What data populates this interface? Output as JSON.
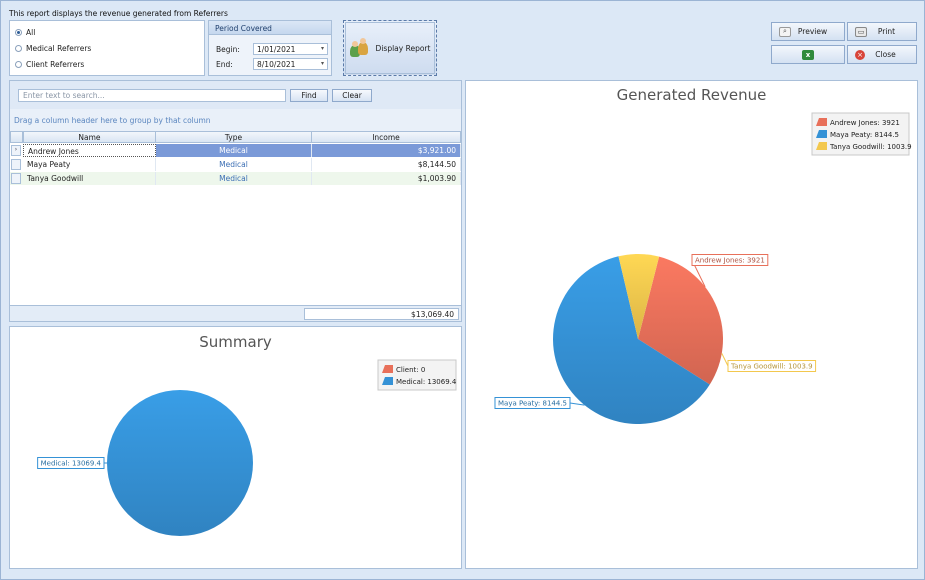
{
  "description": "This report displays the revenue generated from Referrers",
  "filter": {
    "options": [
      {
        "label": "All",
        "selected": true
      },
      {
        "label": "Medical Referrers",
        "selected": false
      },
      {
        "label": "Client Referrers",
        "selected": false
      }
    ]
  },
  "period": {
    "title": "Period Covered",
    "begin_label": "Begin:",
    "begin_value": "1/01/2021",
    "end_label": "End:",
    "end_value": "8/10/2021"
  },
  "display_button": "Display Report",
  "toolbar": {
    "preview": "Preview",
    "print": "Print",
    "close": "Close"
  },
  "search": {
    "placeholder": "Enter text to search...",
    "find": "Find",
    "clear": "Clear"
  },
  "group_hint": "Drag a column header here to group by that column",
  "table": {
    "columns": [
      "Name",
      "Type",
      "Income"
    ],
    "rows": [
      {
        "name": "Andrew Jones",
        "type": "Medical",
        "income": "$3,921.00"
      },
      {
        "name": "Maya Peaty",
        "type": "Medical",
        "income": "$8,144.50"
      },
      {
        "name": "Tanya Goodwill",
        "type": "Medical",
        "income": "$1,003.90"
      }
    ],
    "total": "$13,069.40"
  },
  "colors": {
    "andrew": "#e8705a",
    "maya": "#3592d6",
    "tanya": "#f3c84e"
  },
  "chart_data": [
    {
      "type": "pie",
      "title": "Summary",
      "slices": [
        {
          "label": "Client",
          "value": 0,
          "legend": "Client: 0",
          "color": "#e8705a"
        },
        {
          "label": "Medical",
          "value": 13069.4,
          "legend": "Medical: 13069.4",
          "color": "#3592d6"
        }
      ],
      "callouts": [
        "Medical: 13069.4"
      ],
      "legend_position": "top-right"
    },
    {
      "type": "pie",
      "title": "Generated Revenue",
      "slices": [
        {
          "label": "Andrew Jones",
          "value": 3921,
          "legend": "Andrew Jones: 3921",
          "color": "#e8705a"
        },
        {
          "label": "Maya Peaty",
          "value": 8144.5,
          "legend": "Maya Peaty: 8144.5",
          "color": "#3592d6"
        },
        {
          "label": "Tanya Goodwill",
          "value": 1003.9,
          "legend": "Tanya Goodwill: 1003.9",
          "color": "#f3c84e"
        }
      ],
      "callouts": [
        "Andrew Jones: 3921",
        "Tanya Goodwill: 1003.9",
        "Maya Peaty: 8144.5"
      ],
      "legend_position": "top-right"
    }
  ]
}
